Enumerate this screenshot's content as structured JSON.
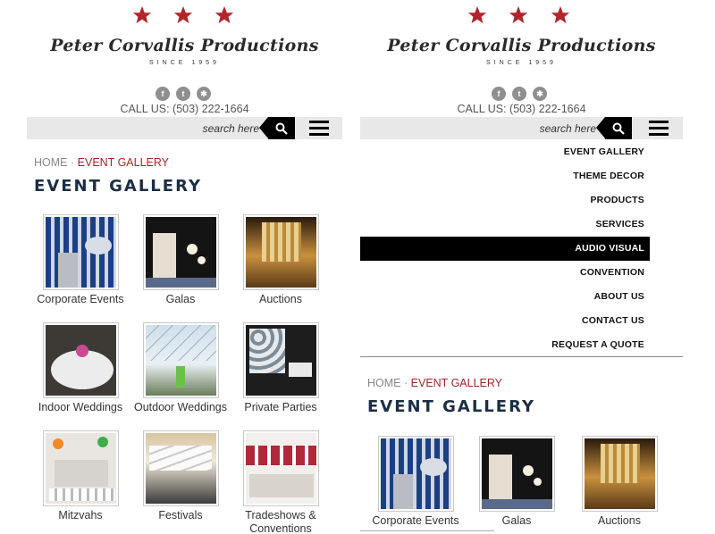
{
  "brand": {
    "logo_text": "Peter Corvallis Productions",
    "since_text": "SINCE 1959",
    "call_us": "CALL US: (503) 222-1664",
    "star_color": "#b3252b"
  },
  "social_icons": [
    {
      "name": "facebook-icon",
      "glyph": "f"
    },
    {
      "name": "twitter-icon",
      "glyph": "t"
    },
    {
      "name": "yelp-icon",
      "glyph": "✱"
    }
  ],
  "search": {
    "placeholder": "search here"
  },
  "breadcrumb": {
    "home": "HOME",
    "separator": "·",
    "current": "EVENT GALLERY"
  },
  "page_title": "EVENT GALLERY",
  "gallery": [
    {
      "caption": "Corporate Events"
    },
    {
      "caption": "Galas"
    },
    {
      "caption": "Auctions"
    },
    {
      "caption": "Indoor Weddings"
    },
    {
      "caption": "Outdoor Weddings"
    },
    {
      "caption": "Private Parties"
    },
    {
      "caption": "Mitzvahs"
    },
    {
      "caption": "Festivals"
    },
    {
      "caption": "Tradeshows & Conventions"
    }
  ],
  "nav_menu": [
    {
      "label": "EVENT GALLERY"
    },
    {
      "label": "THEME DECOR"
    },
    {
      "label": "PRODUCTS"
    },
    {
      "label": "SERVICES"
    },
    {
      "label": "AUDIO VISUAL",
      "active": true
    },
    {
      "label": "CONVENTION"
    },
    {
      "label": "ABOUT US"
    },
    {
      "label": "CONTACT US"
    },
    {
      "label": "REQUEST A QUOTE"
    }
  ]
}
